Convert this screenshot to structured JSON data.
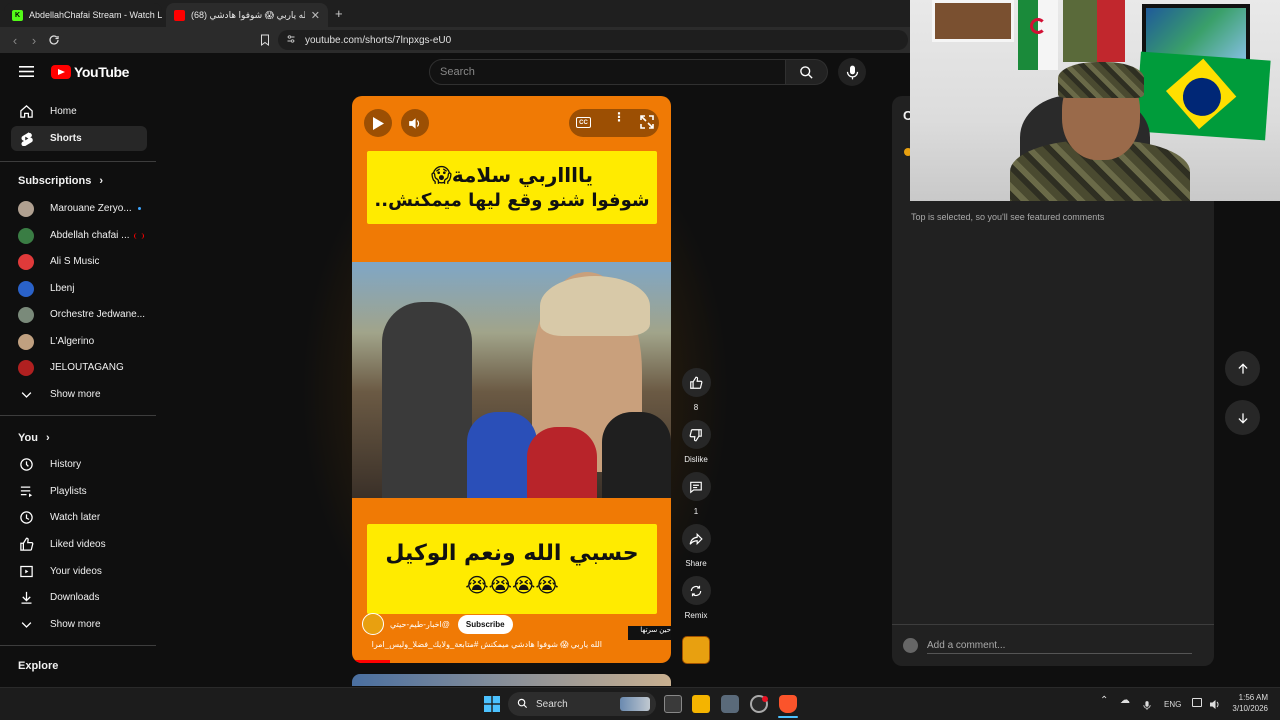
{
  "browser": {
    "tabs": [
      {
        "label": "AbdellahChafai Stream - Watch Live",
        "active": false
      },
      {
        "label": "(68) الله ياربي 😱 شوفوا هادشي ..",
        "active": true
      }
    ],
    "url": "youtube.com/shorts/7lnpxgs-eU0"
  },
  "header": {
    "logo": "YouTube",
    "search_placeholder": "Search"
  },
  "sidebar": {
    "main": [
      {
        "label": "Home",
        "icon": "home-icon"
      },
      {
        "label": "Shorts",
        "icon": "shorts-icon",
        "active": true
      }
    ],
    "subscriptions_title": "Subscriptions",
    "subscriptions": [
      {
        "label": "Marouane Zeryo...",
        "color": "#b0a090",
        "live": "dot"
      },
      {
        "label": "Abdellah chafai ...",
        "color": "#3a7d44",
        "live": "live"
      },
      {
        "label": "Ali S Music",
        "color": "#e03a3a"
      },
      {
        "label": "Lbenj",
        "color": "#2a62c9"
      },
      {
        "label": "Orchestre Jedwane...",
        "color": "#7a8a7a"
      },
      {
        "label": "L'Algerino",
        "color": "#c0a080"
      },
      {
        "label": "JELOUTAGANG",
        "color": "#b02020"
      }
    ],
    "show_more_1": "Show more",
    "you_title": "You",
    "you": [
      {
        "label": "History",
        "icon": "history-icon"
      },
      {
        "label": "Playlists",
        "icon": "playlists-icon"
      },
      {
        "label": "Watch later",
        "icon": "watch-later-icon"
      },
      {
        "label": "Liked videos",
        "icon": "like-icon"
      },
      {
        "label": "Your videos",
        "icon": "your-videos-icon"
      },
      {
        "label": "Downloads",
        "icon": "download-icon"
      }
    ],
    "show_more_2": "Show more",
    "explore_title": "Explore"
  },
  "short": {
    "top_banner_line1": "يااااربي سلامة😱",
    "top_banner_line2": "شوفوا شنو وقع ليها ميمكنش..",
    "bottom_banner_line1": "حسبي الله ونعم الوكيل",
    "bottom_banner_line2": "😭😭😭😭",
    "channel_handle": "@اخبار-طيم-حيتي",
    "subscribe_label": "Subscribe",
    "title": "الله ياربي 😱 شوفوا هادشي ميمكنش #متابعة_ولايك_فضلا_وليس_امرا",
    "side_label": "حين سرتها"
  },
  "actions": {
    "like_count": "8",
    "dislike_label": "Dislike",
    "comment_count": "1",
    "share_label": "Share",
    "remix_label": "Remix"
  },
  "comments": {
    "header_letter": "C",
    "sort_note": "Top is selected, so you'll see featured comments",
    "add_placeholder": "Add a comment..."
  },
  "taskbar": {
    "search_label": "Search",
    "language": "ENG",
    "time": "1:56 AM",
    "date": "3/10/2026"
  },
  "colors": {
    "accent": "#ff0000",
    "player_bg": "#f07a05",
    "banner_yellow": "#ffeb00"
  }
}
